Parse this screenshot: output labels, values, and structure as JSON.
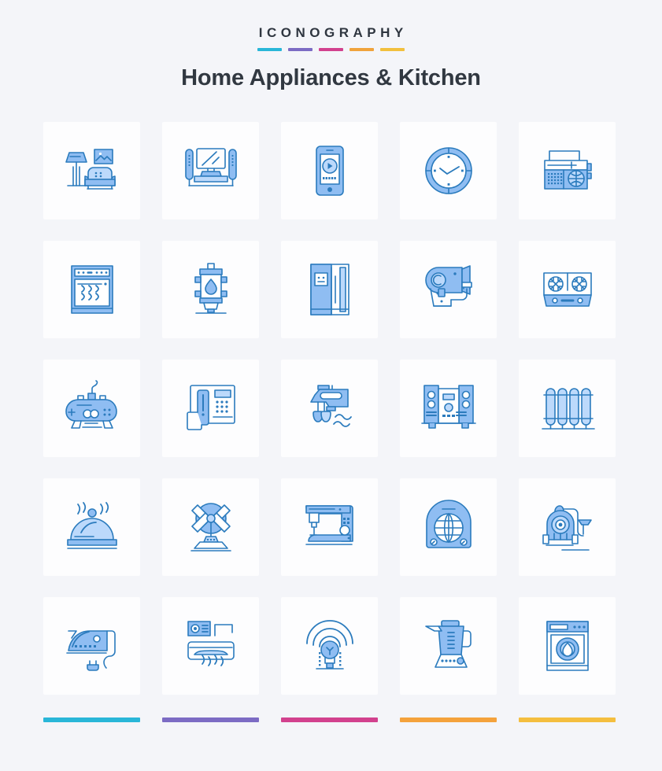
{
  "brand": {
    "word": "ICONOGRAPHY",
    "accent_bars": [
      "#29b6d8",
      "#7c6bc4",
      "#d2418e",
      "#f0a33c",
      "#f2c03e"
    ]
  },
  "suite": {
    "title": "Home Appliances & Kitchen"
  },
  "theme": {
    "page_background": "#f4f5f9",
    "tile_background": "#fdfdfe",
    "icon_stroke": "#2b7bbd",
    "icon_fill": "#8fbdf2",
    "icon_fill_light": "#bcd9fb",
    "title_color": "#313841"
  },
  "footer": {
    "accent_bars": [
      "#29b6d8",
      "#7c6bc4",
      "#d2418e",
      "#f4a23c",
      "#f4be3f"
    ]
  },
  "icons": [
    {
      "index": 1,
      "name": "living-room",
      "label": "Living Room"
    },
    {
      "index": 2,
      "name": "television",
      "label": "Television"
    },
    {
      "index": 3,
      "name": "smartphone",
      "label": "Smartphone"
    },
    {
      "index": 4,
      "name": "wall-clock",
      "label": "Wall Clock"
    },
    {
      "index": 5,
      "name": "radio",
      "label": "Radio"
    },
    {
      "index": 6,
      "name": "oven",
      "label": "Oven"
    },
    {
      "index": 7,
      "name": "water-heater",
      "label": "Water Heater"
    },
    {
      "index": 8,
      "name": "refrigerator",
      "label": "Refrigerator"
    },
    {
      "index": 9,
      "name": "hair-dryer",
      "label": "Hair Dryer"
    },
    {
      "index": 10,
      "name": "gas-stove",
      "label": "Gas Stove"
    },
    {
      "index": 11,
      "name": "game-controller",
      "label": "Game Controller"
    },
    {
      "index": 12,
      "name": "telephone",
      "label": "Telephone"
    },
    {
      "index": 13,
      "name": "hand-mixer",
      "label": "Hand Mixer"
    },
    {
      "index": 14,
      "name": "stereo-system",
      "label": "Stereo System"
    },
    {
      "index": 15,
      "name": "radiator",
      "label": "Radiator"
    },
    {
      "index": 16,
      "name": "food-cloche",
      "label": "Food Cloche"
    },
    {
      "index": 17,
      "name": "table-fan",
      "label": "Table Fan"
    },
    {
      "index": 18,
      "name": "sewing-machine",
      "label": "Sewing Machine"
    },
    {
      "index": 19,
      "name": "room-heater",
      "label": "Room Heater"
    },
    {
      "index": 20,
      "name": "vacuum-cleaner",
      "label": "Vacuum Cleaner"
    },
    {
      "index": 21,
      "name": "clothes-iron",
      "label": "Clothes Iron"
    },
    {
      "index": 22,
      "name": "air-conditioner",
      "label": "Air Conditioner"
    },
    {
      "index": 23,
      "name": "smart-bulb",
      "label": "Smart Bulb"
    },
    {
      "index": 24,
      "name": "blender",
      "label": "Blender"
    },
    {
      "index": 25,
      "name": "washing-machine",
      "label": "Washing Machine"
    }
  ]
}
